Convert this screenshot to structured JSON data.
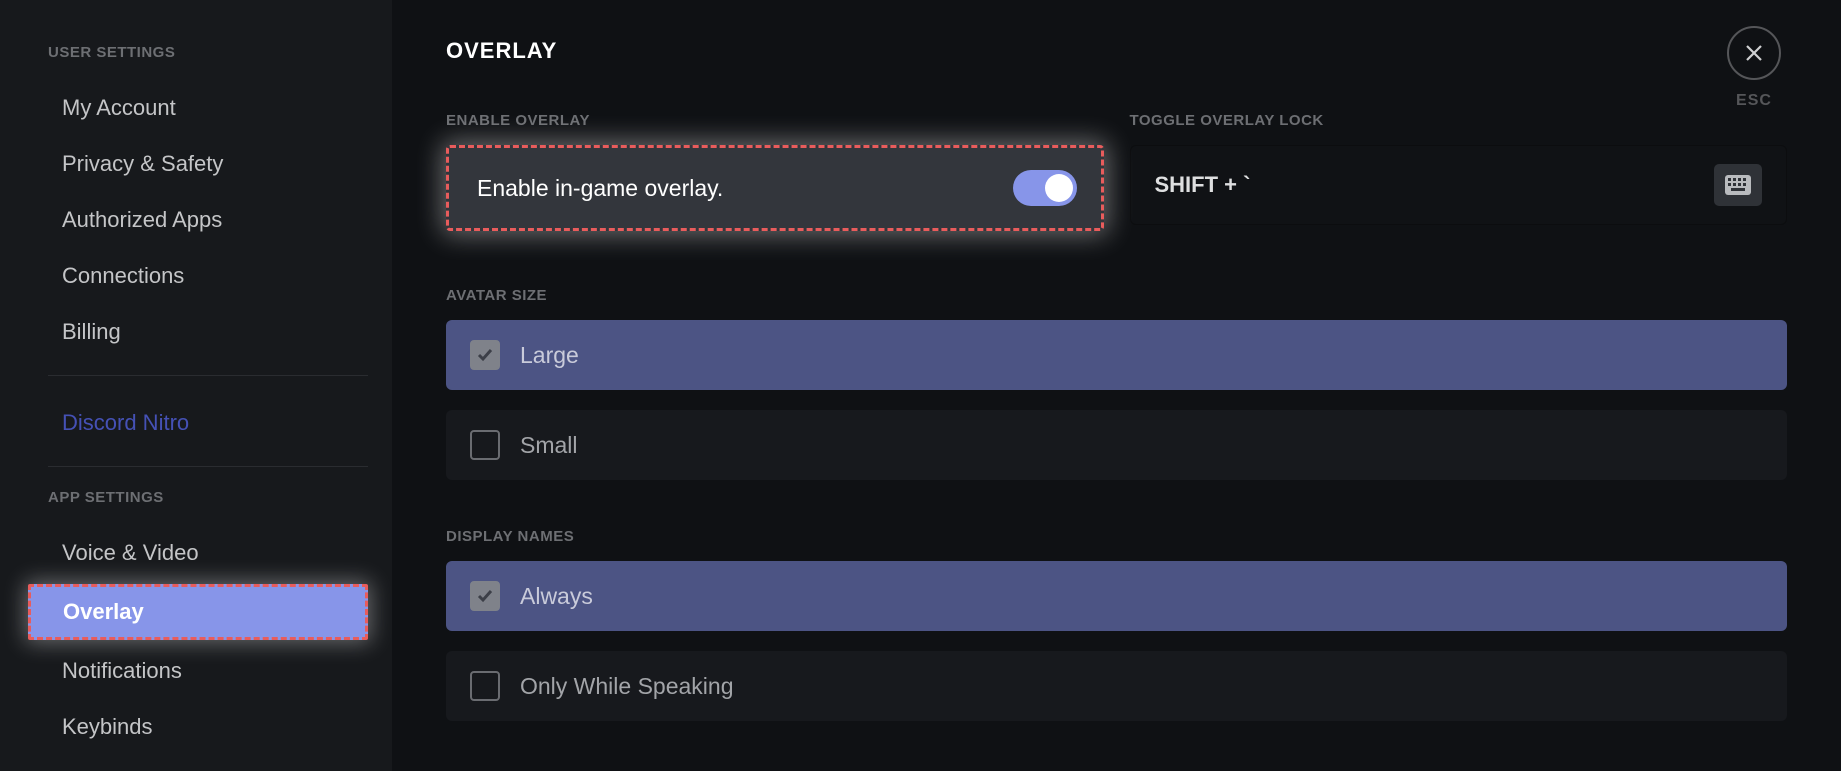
{
  "sidebar": {
    "heading_user": "USER SETTINGS",
    "heading_app": "APP SETTINGS",
    "user_items": [
      {
        "label": "My Account"
      },
      {
        "label": "Privacy & Safety"
      },
      {
        "label": "Authorized Apps"
      },
      {
        "label": "Connections"
      },
      {
        "label": "Billing"
      }
    ],
    "nitro_label": "Discord Nitro",
    "app_items": [
      {
        "label": "Voice & Video",
        "selected": false,
        "highlighted": false
      },
      {
        "label": "Overlay",
        "selected": true,
        "highlighted": true
      },
      {
        "label": "Notifications",
        "selected": false,
        "highlighted": false
      },
      {
        "label": "Keybinds",
        "selected": false,
        "highlighted": false
      }
    ]
  },
  "close": {
    "esc_label": "ESC"
  },
  "content": {
    "page_title": "OVERLAY",
    "enable": {
      "heading": "ENABLE OVERLAY",
      "label": "Enable in-game overlay.",
      "on": true
    },
    "toggle_lock": {
      "heading": "TOGGLE OVERLAY LOCK",
      "value": "SHIFT + `"
    },
    "avatar_size": {
      "heading": "AVATAR SIZE",
      "options": [
        {
          "label": "Large",
          "selected": true
        },
        {
          "label": "Small",
          "selected": false
        }
      ]
    },
    "display_names": {
      "heading": "DISPLAY NAMES",
      "options": [
        {
          "label": "Always",
          "selected": true
        },
        {
          "label": "Only While Speaking",
          "selected": false
        }
      ]
    }
  }
}
